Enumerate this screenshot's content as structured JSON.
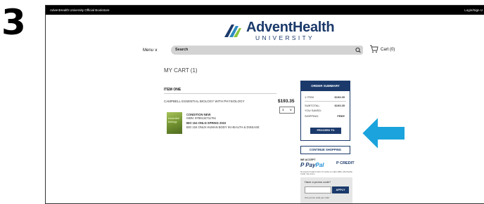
{
  "step": "3",
  "topbar": {
    "store": "AdventHealth University Official Bookstore",
    "login": "Login/Sign U"
  },
  "logo": {
    "title": "AdventHealth",
    "subtitle": "UNIVERSITY"
  },
  "nav": {
    "menu": "Menu ∨",
    "search_placeholder": "Search",
    "cart": "Cart (0)"
  },
  "cart": {
    "heading": "MY CART (1)",
    "item_heading": "ITEM ONE",
    "book_title": "CAMPBELL ESSENTIAL BIOLOGY WITH PHYSIOLOGY",
    "price": "$193.35",
    "qty": "1",
    "cover_text": "essential biology",
    "condition": "CONDITION NEW",
    "isbn": "ISBN: 9780134711751",
    "course": "BIO 104 ONLN  SPRING 2022",
    "course_name": "BIO 104 ONLN HUMAN BODY IN HEALTH & DISEASE"
  },
  "summary": {
    "title": "ORDER SUMMARY",
    "rows": [
      {
        "label": "1 ITEM",
        "value": "$193.35"
      },
      {
        "label": "SUBTOTAL:",
        "value": "$193.35"
      },
      {
        "label": "YOU SAVED:",
        "value": ""
      },
      {
        "label": "SHIPPING:",
        "value": "FREE"
      }
    ],
    "checkout": "PROCEED TO CHECKOUT",
    "continue": "CONTINUE SHOPPING"
  },
  "payment": {
    "accept": "WE ACCEPT",
    "paypal_1": "Pay",
    "paypal_2": "Pal",
    "credit": "CREDIT",
    "fine": "No interest if paid in full in 6 months on orders $99+ with PayPal Credit. See terms."
  },
  "promo": {
    "label": "Have a promo code?",
    "apply": "APPLY",
    "note": "One promo code per order"
  },
  "colors": {
    "brand": "#1b3a6b",
    "callout": "#1aa3dc"
  }
}
